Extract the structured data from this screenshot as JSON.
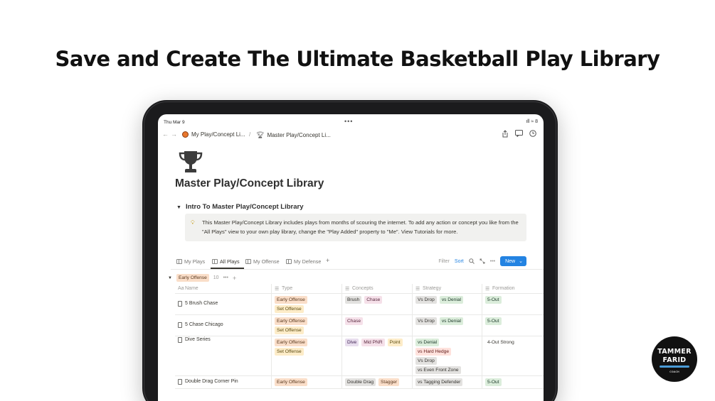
{
  "headline": "Save and Create The Ultimate Basketball Play Library",
  "status": {
    "time": "Thu Mar 9",
    "dots": "•••",
    "indicators": "ıll ≈ 8"
  },
  "nav": {
    "back": "←",
    "forward": "→",
    "crumb1": "My Play/Concept Li...",
    "sep": "/",
    "crumb2": "Master Play/Concept Li..."
  },
  "page": {
    "title": "Master Play/Concept Library",
    "toggle": "Intro To Master Play/Concept Library",
    "callout": "This Master Play/Concept Library includes plays from months of scouring the internet. To add any action or concept you like from the \"All Plays\" view to your own play library, change the \"Play Added\" property to \"Me\". View Tutorials for more."
  },
  "tabs": [
    {
      "label": "My Plays"
    },
    {
      "label": "All Plays"
    },
    {
      "label": "My Offense"
    },
    {
      "label": "My Defense"
    }
  ],
  "actions": {
    "filter": "Filter",
    "sort": "Sort",
    "new": "New"
  },
  "group": {
    "label": "Early Offense",
    "count": "10"
  },
  "columns": {
    "name": "Name",
    "type": "Type",
    "concepts": "Concepts",
    "strategy": "Strategy",
    "formation": "Formation",
    "name_icon": "Aa"
  },
  "rows": [
    {
      "name": "5 Brush Chase",
      "type": [
        "Early Offense",
        "Set Offense"
      ],
      "concepts": [
        "Brush",
        "Chase"
      ],
      "strategy": [
        "Vs Drop",
        "vs Denial"
      ],
      "formation": "5-Out"
    },
    {
      "name": "5 Chase Chicago",
      "type": [
        "Early Offense",
        "Set Offense"
      ],
      "concepts": [
        "Chase"
      ],
      "strategy": [
        "Vs Drop",
        "vs Denial"
      ],
      "formation": "5-Out"
    },
    {
      "name": "Dive Series",
      "type": [
        "Early Offense",
        "Set Offense"
      ],
      "concepts": [
        "Dive",
        "Mid PNR",
        "Point"
      ],
      "strategy": [
        "vs Denial",
        "vs Hard Hedge",
        "Vs Drop",
        "vs Even Front Zone"
      ],
      "formation": "4-Out Strong"
    },
    {
      "name": "Double Drag Corner Pin",
      "type": [
        "Early Offense"
      ],
      "concepts": [
        "Double Drag",
        "Stagger"
      ],
      "strategy": [
        "vs Tagging Defender"
      ],
      "formation": "5-Out"
    }
  ],
  "badge": {
    "line1": "TAMMER",
    "line2": "FARID",
    "line3": "COACH"
  },
  "colors": {
    "new_button": "#2383e2",
    "tablet_frame": "#1b1b1d"
  }
}
